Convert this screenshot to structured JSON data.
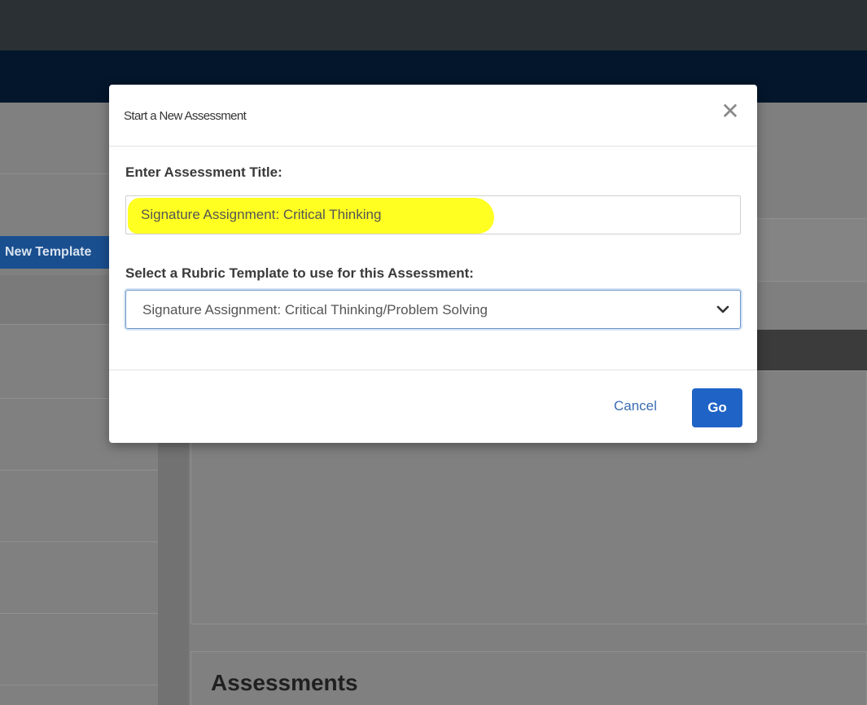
{
  "background": {
    "template_button_label": "New Template",
    "assessments_heading": "Assessments"
  },
  "modal": {
    "title": "Start a New Assessment",
    "close_icon": "close-icon",
    "title_field": {
      "label": "Enter Assessment Title:",
      "value": "Signature Assignment: Critical Thinking"
    },
    "template_field": {
      "label": "Select a Rubric Template to use for this Assessment:",
      "selected": "Signature Assignment: Critical Thinking/Problem Solving"
    },
    "cancel_label": "Cancel",
    "go_label": "Go"
  },
  "colors": {
    "highlight": "#ffff22",
    "primary": "#1f63c6",
    "link": "#3b6db3"
  }
}
